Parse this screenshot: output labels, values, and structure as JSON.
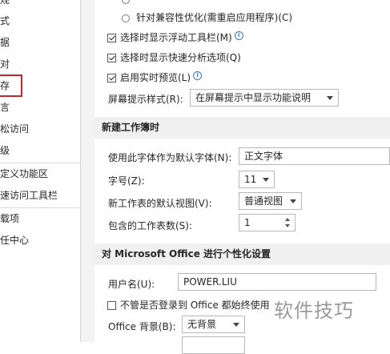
{
  "sidebar": {
    "items": [
      {
        "label": "规"
      },
      {
        "label": "式"
      },
      {
        "label": "据"
      },
      {
        "label": "对"
      },
      {
        "label": "存"
      },
      {
        "label": "言"
      },
      {
        "label": "松访问"
      },
      {
        "label": "级"
      },
      {
        "label": "定义功能区"
      },
      {
        "label": "速访问工具栏"
      },
      {
        "label": "载项"
      },
      {
        "label": "任中心"
      }
    ]
  },
  "options": {
    "radio_compat": "针对兼容性优化(需重启应用程序)(C)",
    "show_mini_toolbar": "选择时显示浮动工具栏(M)",
    "show_quick_analysis": "选择时显示快速分析选项(Q)",
    "live_preview": "启用实时预览(L)",
    "screentip_label": "屏幕提示样式(R):",
    "screentip_value": "在屏幕提示中显示功能说明"
  },
  "new_workbook": {
    "heading": "新建工作簿时",
    "font_label": "使用此字体作为默认字体(N):",
    "font_value": "正文字体",
    "size_label": "字号(Z):",
    "size_value": "11",
    "view_label": "新工作表的默认视图(V):",
    "view_value": "普通视图",
    "sheets_label": "包含的工作表数(S):",
    "sheets_value": "1"
  },
  "personalize": {
    "heading": "对 Microsoft Office 进行个性化设置",
    "username_label": "用户名(U):",
    "username_value": "POWER.LIU",
    "always_use_label": "不管是否登录到 Office 都始终使用",
    "background_label": "Office 背景(B):",
    "background_value": "无背景"
  },
  "watermark": "软件技巧"
}
